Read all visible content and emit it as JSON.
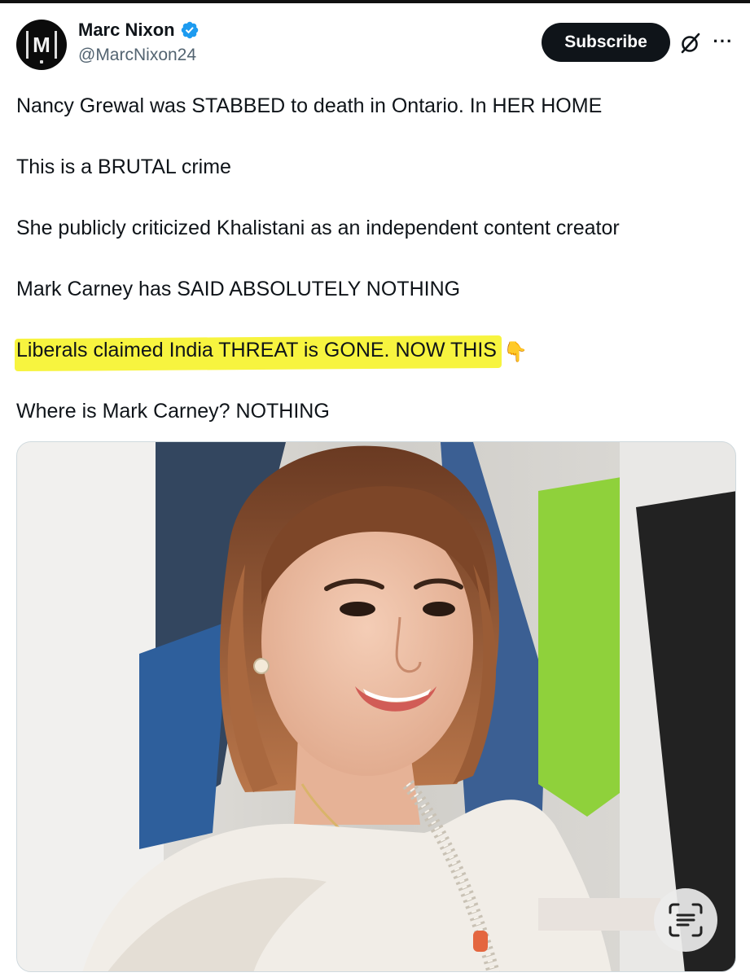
{
  "author": {
    "display_name": "Marc Nixon",
    "handle": "@MarcNixon24",
    "avatar_letter": "M"
  },
  "actions": {
    "subscribe_label": "Subscribe"
  },
  "post": {
    "lines": [
      "Nancy Grewal was STABBED to death in Ontario. In HER HOME",
      "This is a BRUTAL crime",
      "She publicly criticized Khalistani as an independent content creator",
      "Mark Carney has SAID ABSOLUTELY NOTHING",
      "Liberals claimed India THREAT is GONE. NOW THIS",
      "Where is Mark Carney? NOTHING"
    ],
    "emoji": "👇"
  },
  "colors": {
    "verified": "#1d9bf0",
    "highlight": "#f6f32a",
    "button_bg": "#0f1419"
  },
  "icons": {
    "verified": "verified-badge-icon",
    "grok": "grok-icon",
    "more": "more-icon",
    "text_lens": "text-scan-icon"
  }
}
